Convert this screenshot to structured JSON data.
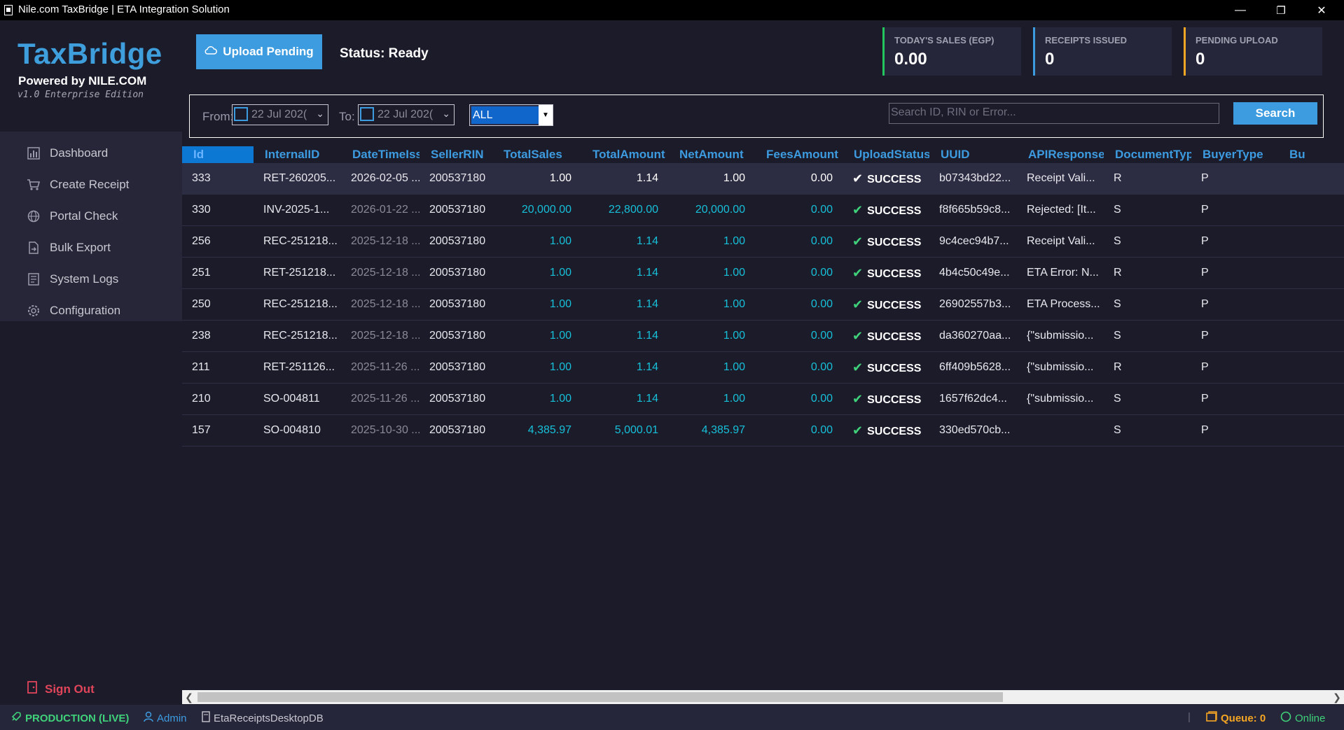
{
  "window": {
    "title": "Nile.com TaxBridge | ETA Integration Solution",
    "minimize": "—",
    "restore": "❐",
    "close": "✕"
  },
  "brand": {
    "title": "TaxBridge",
    "powered_by": "Powered by NILE.COM",
    "version": "v1.0 Enterprise Edition"
  },
  "sidebar": {
    "items": [
      {
        "label": "Dashboard",
        "icon": "bar-chart-icon"
      },
      {
        "label": "Create Receipt",
        "icon": "cart-icon"
      },
      {
        "label": "Portal Check",
        "icon": "globe-icon"
      },
      {
        "label": "Bulk Export",
        "icon": "export-icon"
      },
      {
        "label": "System Logs",
        "icon": "logs-icon"
      },
      {
        "label": "Configuration",
        "icon": "gear-icon"
      }
    ],
    "sign_out": "Sign Out"
  },
  "toolbar": {
    "upload_label": "Upload Pending",
    "status_text": "Status: Ready"
  },
  "stats": [
    {
      "label": "TODAY'S SALES (EGP)",
      "value": "0.00",
      "accent": "#22c55e"
    },
    {
      "label": "RECEIPTS ISSUED",
      "value": "0",
      "accent": "#3d9be0"
    },
    {
      "label": "PENDING UPLOAD",
      "value": "0",
      "accent": "#f5a623"
    }
  ],
  "filters": {
    "from_label": "From:",
    "from_value": "22  Jul  202(",
    "to_label": "To:",
    "to_value": "22  Jul  202(",
    "type_value": "ALL",
    "search_placeholder": "Search ID, RIN or Error...",
    "search_button": "Search"
  },
  "grid": {
    "columns": [
      "Id",
      "InternalID",
      "DateTimeIssu",
      "SellerRIN",
      "TotalSales",
      "TotalAmount",
      "NetAmount",
      "FeesAmount",
      "UploadStatus",
      "UUID",
      "APIResponse",
      "DocumentTyp",
      "BuyerType",
      "Bu"
    ],
    "rows": [
      {
        "id": "333",
        "internal": "RET-260205...",
        "date": "2026-02-05 ...",
        "rin": "200537180",
        "sales": "1.00",
        "amount": "1.14",
        "net": "1.00",
        "fees": "0.00",
        "status": "SUCCESS",
        "uuid": "b07343bd22...",
        "api": "Receipt Vali...",
        "doctype": "R",
        "buyer": "P"
      },
      {
        "id": "330",
        "internal": "INV-2025-1...",
        "date": "2026-01-22 ...",
        "rin": "200537180",
        "sales": "20,000.00",
        "amount": "22,800.00",
        "net": "20,000.00",
        "fees": "0.00",
        "status": "SUCCESS",
        "uuid": "f8f665b59c8...",
        "api": "Rejected: [It...",
        "doctype": "S",
        "buyer": "P"
      },
      {
        "id": "256",
        "internal": "REC-251218...",
        "date": "2025-12-18 ...",
        "rin": "200537180",
        "sales": "1.00",
        "amount": "1.14",
        "net": "1.00",
        "fees": "0.00",
        "status": "SUCCESS",
        "uuid": "9c4cec94b7...",
        "api": "Receipt Vali...",
        "doctype": "S",
        "buyer": "P"
      },
      {
        "id": "251",
        "internal": "RET-251218...",
        "date": "2025-12-18 ...",
        "rin": "200537180",
        "sales": "1.00",
        "amount": "1.14",
        "net": "1.00",
        "fees": "0.00",
        "status": "SUCCESS",
        "uuid": "4b4c50c49e...",
        "api": "ETA Error: N...",
        "doctype": "R",
        "buyer": "P"
      },
      {
        "id": "250",
        "internal": "REC-251218...",
        "date": "2025-12-18 ...",
        "rin": "200537180",
        "sales": "1.00",
        "amount": "1.14",
        "net": "1.00",
        "fees": "0.00",
        "status": "SUCCESS",
        "uuid": "26902557b3...",
        "api": "ETA Process...",
        "doctype": "S",
        "buyer": "P"
      },
      {
        "id": "238",
        "internal": "REC-251218...",
        "date": "2025-12-18 ...",
        "rin": "200537180",
        "sales": "1.00",
        "amount": "1.14",
        "net": "1.00",
        "fees": "0.00",
        "status": "SUCCESS",
        "uuid": "da360270aa...",
        "api": "{\"submissio...",
        "doctype": "S",
        "buyer": "P"
      },
      {
        "id": "211",
        "internal": "RET-251126...",
        "date": "2025-11-26 ...",
        "rin": "200537180",
        "sales": "1.00",
        "amount": "1.14",
        "net": "1.00",
        "fees": "0.00",
        "status": "SUCCESS",
        "uuid": "6ff409b5628...",
        "api": "{\"submissio...",
        "doctype": "R",
        "buyer": "P"
      },
      {
        "id": "210",
        "internal": "SO-004811",
        "date": "2025-11-26 ...",
        "rin": "200537180",
        "sales": "1.00",
        "amount": "1.14",
        "net": "1.00",
        "fees": "0.00",
        "status": "SUCCESS",
        "uuid": "1657f62dc4...",
        "api": "{\"submissio...",
        "doctype": "S",
        "buyer": "P"
      },
      {
        "id": "157",
        "internal": "SO-004810",
        "date": "2025-10-30 ...",
        "rin": "200537180",
        "sales": "4,385.97",
        "amount": "5,000.01",
        "net": "4,385.97",
        "fees": "0.00",
        "status": "SUCCESS",
        "uuid": "330ed570cb...",
        "api": "",
        "doctype": "S",
        "buyer": "P"
      }
    ]
  },
  "statusbar": {
    "environment": "PRODUCTION (LIVE)",
    "user": "Admin",
    "database": "EtaReceiptsDesktopDB",
    "separator": "|",
    "queue": "Queue: 0",
    "connection": "Online"
  }
}
